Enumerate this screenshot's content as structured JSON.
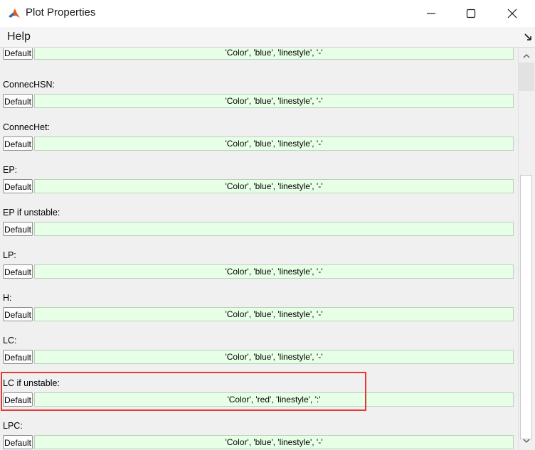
{
  "window": {
    "title": "Plot Properties",
    "minimize_icon": "minimize-icon",
    "maximize_icon": "maximize-icon",
    "close_icon": "close-icon"
  },
  "menubar": {
    "help_label": "Help",
    "dock_icon": "dock-arrow-icon"
  },
  "default_label": "Default",
  "rows": [
    {
      "label": "",
      "value": "'Color', 'blue', 'linestyle', '-'"
    },
    {
      "label": "ConnecHSN:",
      "value": "'Color', 'blue', 'linestyle', '-'"
    },
    {
      "label": "ConnecHet:",
      "value": "'Color', 'blue', 'linestyle', '-'"
    },
    {
      "label": "EP:",
      "value": "'Color', 'blue', 'linestyle', '-'"
    },
    {
      "label": "EP if unstable:",
      "value": ""
    },
    {
      "label": "LP:",
      "value": "'Color', 'blue', 'linestyle', '-'"
    },
    {
      "label": "H:",
      "value": "'Color', 'blue', 'linestyle', '-'"
    },
    {
      "label": "LC:",
      "value": "'Color', 'blue', 'linestyle', '-'"
    },
    {
      "label": "LC if unstable:",
      "value": "'Color', 'red', 'linestyle', ':'"
    },
    {
      "label": "LPC:",
      "value": "'Color', 'blue', 'linestyle', '-'"
    }
  ],
  "colors": {
    "field_bg": "#e6ffe6",
    "highlight_border": "#e53935"
  }
}
